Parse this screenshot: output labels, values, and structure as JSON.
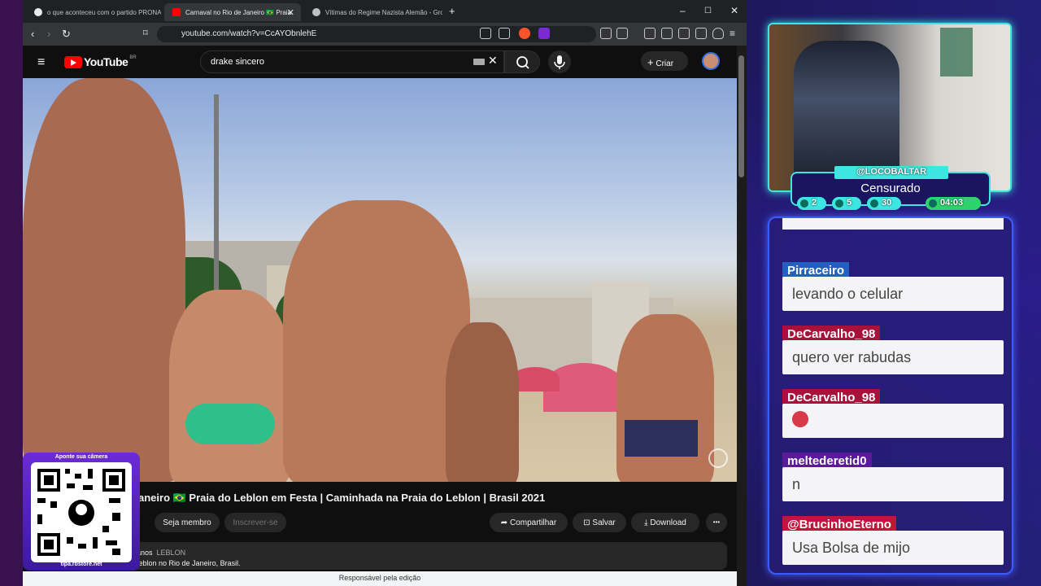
{
  "browser": {
    "tabs": [
      {
        "label": "o que aconteceu com o partido PRONA - Pe",
        "favicon_color": "#e8eaed"
      },
      {
        "label": "Carnaval no Rio de Janeiro 🇧🇷 Praia",
        "favicon_color": "#ff0000"
      },
      {
        "label": "Vítimas do Regime Nazista Alemão - Grok",
        "favicon_color": "#bdc1c6"
      }
    ],
    "new_tab": "+",
    "controls": {
      "minimize": "–",
      "maximize": "☐",
      "close": "✕"
    },
    "url": "youtube.com/watch?v=CcAYObnlehE",
    "status_text": "Responsável pela edição"
  },
  "youtube": {
    "logo_text": "YouTube",
    "logo_region": "BR",
    "search_value": "drake sincero",
    "create_label": "Criar",
    "video_title": "aneiro 🇧🇷 Praia do Leblon em Festa | Caminhada na Praia do Leblon | Brasil 2021",
    "join_label": "Seja membro",
    "subscribe_label": "Inscrever-se",
    "share_label": "Compartilhar",
    "save_label": "Salvar",
    "download_label": "Download",
    "more_label": "•••",
    "desc_meta": "anos",
    "desc_tag": "LEBLON",
    "desc_text": "o Leblon no Rio de Janeiro, Brasil."
  },
  "overlay": {
    "qr_top": "Aponte sua câmera",
    "qr_bottom": "tipa.rbstore.net",
    "cam_user": "@LOCOBALTAR",
    "cam_label": "Censurado",
    "stats": [
      {
        "icon": "chat-icon",
        "value": "2"
      },
      {
        "icon": "youtube-icon",
        "value": "5"
      },
      {
        "icon": "kick-icon",
        "value": "30"
      },
      {
        "icon": "clock-icon",
        "value": "04:03"
      }
    ],
    "accent": "#3de6e0"
  },
  "chat": [
    {
      "user": "Pirraceiro",
      "text": "levando o celular",
      "color": "#2460c0"
    },
    {
      "user": "DeCarvalho_98",
      "text": "quero ver rabudas",
      "color": "#a8123a"
    },
    {
      "user": "DeCarvalho_98",
      "text": "",
      "emoji": "sick-face-emoji",
      "color": "#a8123a"
    },
    {
      "user": "meltederetid0",
      "text": "n",
      "color": "#5a1a9a"
    },
    {
      "user": "@BrucinhoEterno",
      "text": "Usa Bolsa de mijo",
      "color": "#c0163a"
    }
  ]
}
